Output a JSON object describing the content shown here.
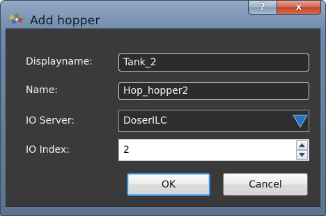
{
  "window": {
    "title": "Add hopper",
    "help_label": "?",
    "close_label": "x",
    "icon": "puzzle-app-icon"
  },
  "form": {
    "displayname_label": "Displayname:",
    "displayname_value": "Tank_2",
    "name_label": "Name:",
    "name_value": "Hop_hopper2",
    "io_server_label": "IO Server:",
    "io_server_value": "DoserILC",
    "io_index_label": "IO Index:",
    "io_index_value": "2"
  },
  "buttons": {
    "ok_label": "OK",
    "cancel_label": "Cancel"
  },
  "colors": {
    "dialog_background": "#3a3a3a",
    "title_bar": "#7f98b8",
    "close_button": "#c2452c",
    "default_button_border": "#3a8ede",
    "dropdown_arrow": "#2a6ebe"
  }
}
